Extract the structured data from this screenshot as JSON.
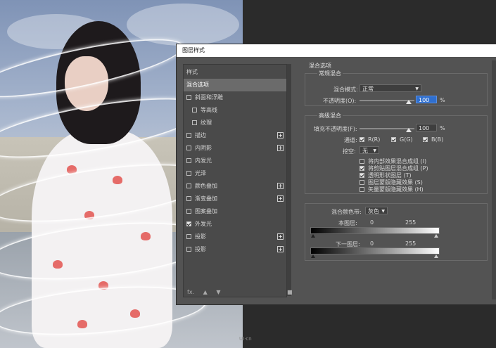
{
  "dialog": {
    "title": "图层样式",
    "style_list": {
      "header": "样式",
      "items": [
        {
          "label": "混合选项",
          "checkbox": false,
          "checked": false,
          "plus": false,
          "selected": true,
          "indent": 0
        },
        {
          "label": "斜面和浮雕",
          "checkbox": true,
          "checked": false,
          "plus": false,
          "selected": false,
          "indent": 0
        },
        {
          "label": "等高线",
          "checkbox": true,
          "checked": false,
          "plus": false,
          "selected": false,
          "indent": 1
        },
        {
          "label": "纹理",
          "checkbox": true,
          "checked": false,
          "plus": false,
          "selected": false,
          "indent": 1
        },
        {
          "label": "描边",
          "checkbox": true,
          "checked": false,
          "plus": true,
          "selected": false,
          "indent": 0
        },
        {
          "label": "内阴影",
          "checkbox": true,
          "checked": false,
          "plus": true,
          "selected": false,
          "indent": 0
        },
        {
          "label": "内发光",
          "checkbox": true,
          "checked": false,
          "plus": false,
          "selected": false,
          "indent": 0
        },
        {
          "label": "光泽",
          "checkbox": true,
          "checked": false,
          "plus": false,
          "selected": false,
          "indent": 0
        },
        {
          "label": "颜色叠加",
          "checkbox": true,
          "checked": false,
          "plus": true,
          "selected": false,
          "indent": 0
        },
        {
          "label": "渐变叠加",
          "checkbox": true,
          "checked": false,
          "plus": true,
          "selected": false,
          "indent": 0
        },
        {
          "label": "图案叠加",
          "checkbox": true,
          "checked": false,
          "plus": false,
          "selected": false,
          "indent": 0
        },
        {
          "label": "外发光",
          "checkbox": true,
          "checked": true,
          "plus": false,
          "selected": false,
          "indent": 0
        },
        {
          "label": "投影",
          "checkbox": true,
          "checked": false,
          "plus": true,
          "selected": false,
          "indent": 0
        },
        {
          "label": "投影",
          "checkbox": true,
          "checked": false,
          "plus": true,
          "selected": false,
          "indent": 0
        }
      ],
      "footer_fx": "fx."
    },
    "blend_options": {
      "section_title": "混合选项",
      "general": {
        "title": "常规混合",
        "blend_mode_label": "混合模式:",
        "blend_mode_value": "正常",
        "opacity_label": "不透明度(O):",
        "opacity_value": "100",
        "percent": "%"
      },
      "advanced": {
        "title": "高级混合",
        "fill_opacity_label": "填充不透明度(F):",
        "fill_opacity_value": "100",
        "percent": "%",
        "channels_label": "通道:",
        "channels": [
          {
            "label": "R(R)",
            "checked": true
          },
          {
            "label": "G(G)",
            "checked": true
          },
          {
            "label": "B(B)",
            "checked": true
          }
        ],
        "knockout_label": "挖空:",
        "knockout_value": "无",
        "options": [
          {
            "label": "将内部效果混合成组 (I)",
            "checked": false
          },
          {
            "label": "将剪贴图层混合成组 (P)",
            "checked": true
          },
          {
            "label": "透明形状图层 (T)",
            "checked": true
          },
          {
            "label": "图层蒙版隐藏效果 (S)",
            "checked": false
          },
          {
            "label": "矢量蒙版隐藏效果 (H)",
            "checked": false
          }
        ]
      },
      "blend_if": {
        "label": "混合颜色带:",
        "value": "灰色",
        "this_layer_label": "本图层:",
        "this_layer_min": "0",
        "this_layer_max": "255",
        "underlying_label": "下一图层:",
        "underlying_min": "0",
        "underlying_max": "255"
      }
    }
  },
  "watermark": "UI·cn"
}
